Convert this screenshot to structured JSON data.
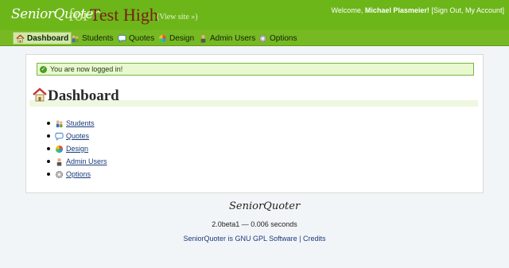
{
  "header": {
    "logo_text": "SeniorQuoter",
    "for_text": "for",
    "school_name": "Test High",
    "view_site": "(View site »)",
    "welcome": "Welcome,",
    "user_name": "Michael Plasmeier!",
    "sign_out": "[Sign Out,",
    "my_account": "My Account]"
  },
  "nav": {
    "items": [
      {
        "label": "Dashboard",
        "icon": "house-icon"
      },
      {
        "label": "Students",
        "icon": "students-icon"
      },
      {
        "label": "Quotes",
        "icon": "quotes-icon"
      },
      {
        "label": "Design",
        "icon": "design-icon"
      },
      {
        "label": "Admin Users",
        "icon": "admin-users-icon"
      },
      {
        "label": "Options",
        "icon": "gear-icon"
      }
    ],
    "active": "Dashboard"
  },
  "main": {
    "notice": "You are now logged in!",
    "title": "Dashboard",
    "links": [
      {
        "label": "Students",
        "icon": "students-icon"
      },
      {
        "label": "Quotes",
        "icon": "quotes-icon"
      },
      {
        "label": "Design",
        "icon": "design-icon"
      },
      {
        "label": "Admin Users",
        "icon": "admin-users-icon"
      },
      {
        "label": "Options",
        "icon": "gear-icon"
      }
    ]
  },
  "footer": {
    "logo_text": "SeniorQuoter",
    "version": "2.0beta1 — 0.006 seconds",
    "license_prefix": "SeniorQuoter is GNU GPL Software |",
    "credits": "Credits"
  },
  "colors": {
    "header_green": "#6cb61a",
    "nav_green": "#77b923",
    "notice_bg": "#e8f8cf",
    "link_blue": "#1a3b7a",
    "school_red": "#7a1f14"
  }
}
